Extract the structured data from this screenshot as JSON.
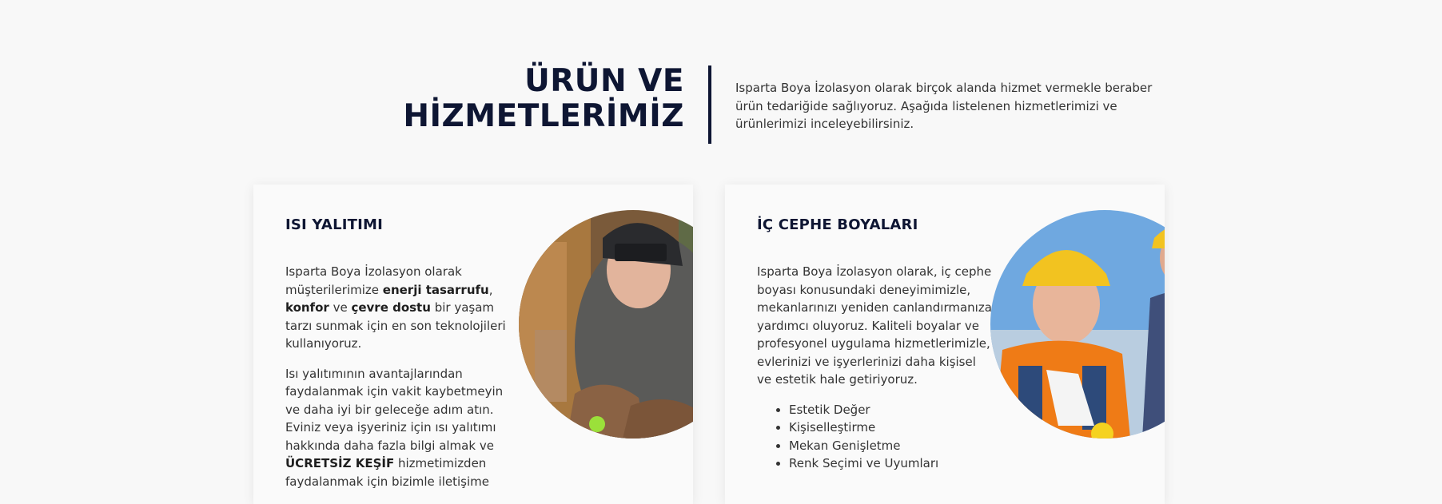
{
  "header": {
    "title_line1": "ÜRÜN VE",
    "title_line2": "HİZMETLERİMİZ",
    "intro": "Isparta Boya İzolasyon olarak birçok alanda hizmet vermekle beraber ürün tedariğide sağlıyoruz. Aşağıda listelenen hizmetlerimizi ve ürünlerimizi inceleyebilirsiniz."
  },
  "cards": [
    {
      "title": "ISI YALITIMI",
      "p1_a": "Isparta Boya İzolasyon olarak müşterilerimize ",
      "p1_b": "enerji tasarrufu",
      "p1_c": ", ",
      "p1_d": "konfor",
      "p1_e": " ve ",
      "p1_f": "çevre dostu",
      "p1_g": " bir yaşam tarzı sunmak için en son teknolojileri kullanıyoruz.",
      "p2_a": "Isı yalıtımının avantajlarından faydalanmak için vakit kaybetmeyin ve daha iyi bir geleceğe adım atın. Eviniz veya işyeriniz için ısı yalıtımı hakkında daha fazla bilgi almak ve ",
      "p2_b": "ÜCRETSİZ KEŞİF",
      "p2_c": " hizmetimizden faydalanmak için bizimle iletişime",
      "image_icon": "welder-photo"
    },
    {
      "title": "İÇ CEPHE BOYALARI",
      "p1": "Isparta Boya İzolasyon olarak, iç cephe boyası konusundaki deneyimimizle, mekanlarınızı yeniden canlandırmanıza yardımcı oluyoruz. Kaliteli boyalar ve profesyonel uygulama hizmetlerimizle, evlerinizi ve işyerlerinizi daha kişisel ve estetik hale getiriyoruz.",
      "list": [
        "Estetik Değer",
        "Kişiselleştirme",
        "Mekan Genişletme",
        "Renk Seçimi ve Uyumları"
      ],
      "image_icon": "engineers-photo"
    }
  ],
  "colors": {
    "navy": "#0e1633",
    "background": "#f8f8f8"
  }
}
